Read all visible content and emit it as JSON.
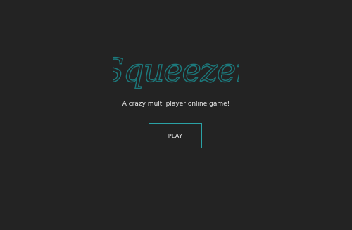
{
  "game": {
    "logo_text": "Squeezer",
    "tagline": "A crazy multi player online game!",
    "play_label": "PLAY"
  },
  "colors": {
    "background": "#232323",
    "logo_outline": "#1c7a7d",
    "button_border": "#2aa2a6",
    "text": "#e9e9e9"
  }
}
